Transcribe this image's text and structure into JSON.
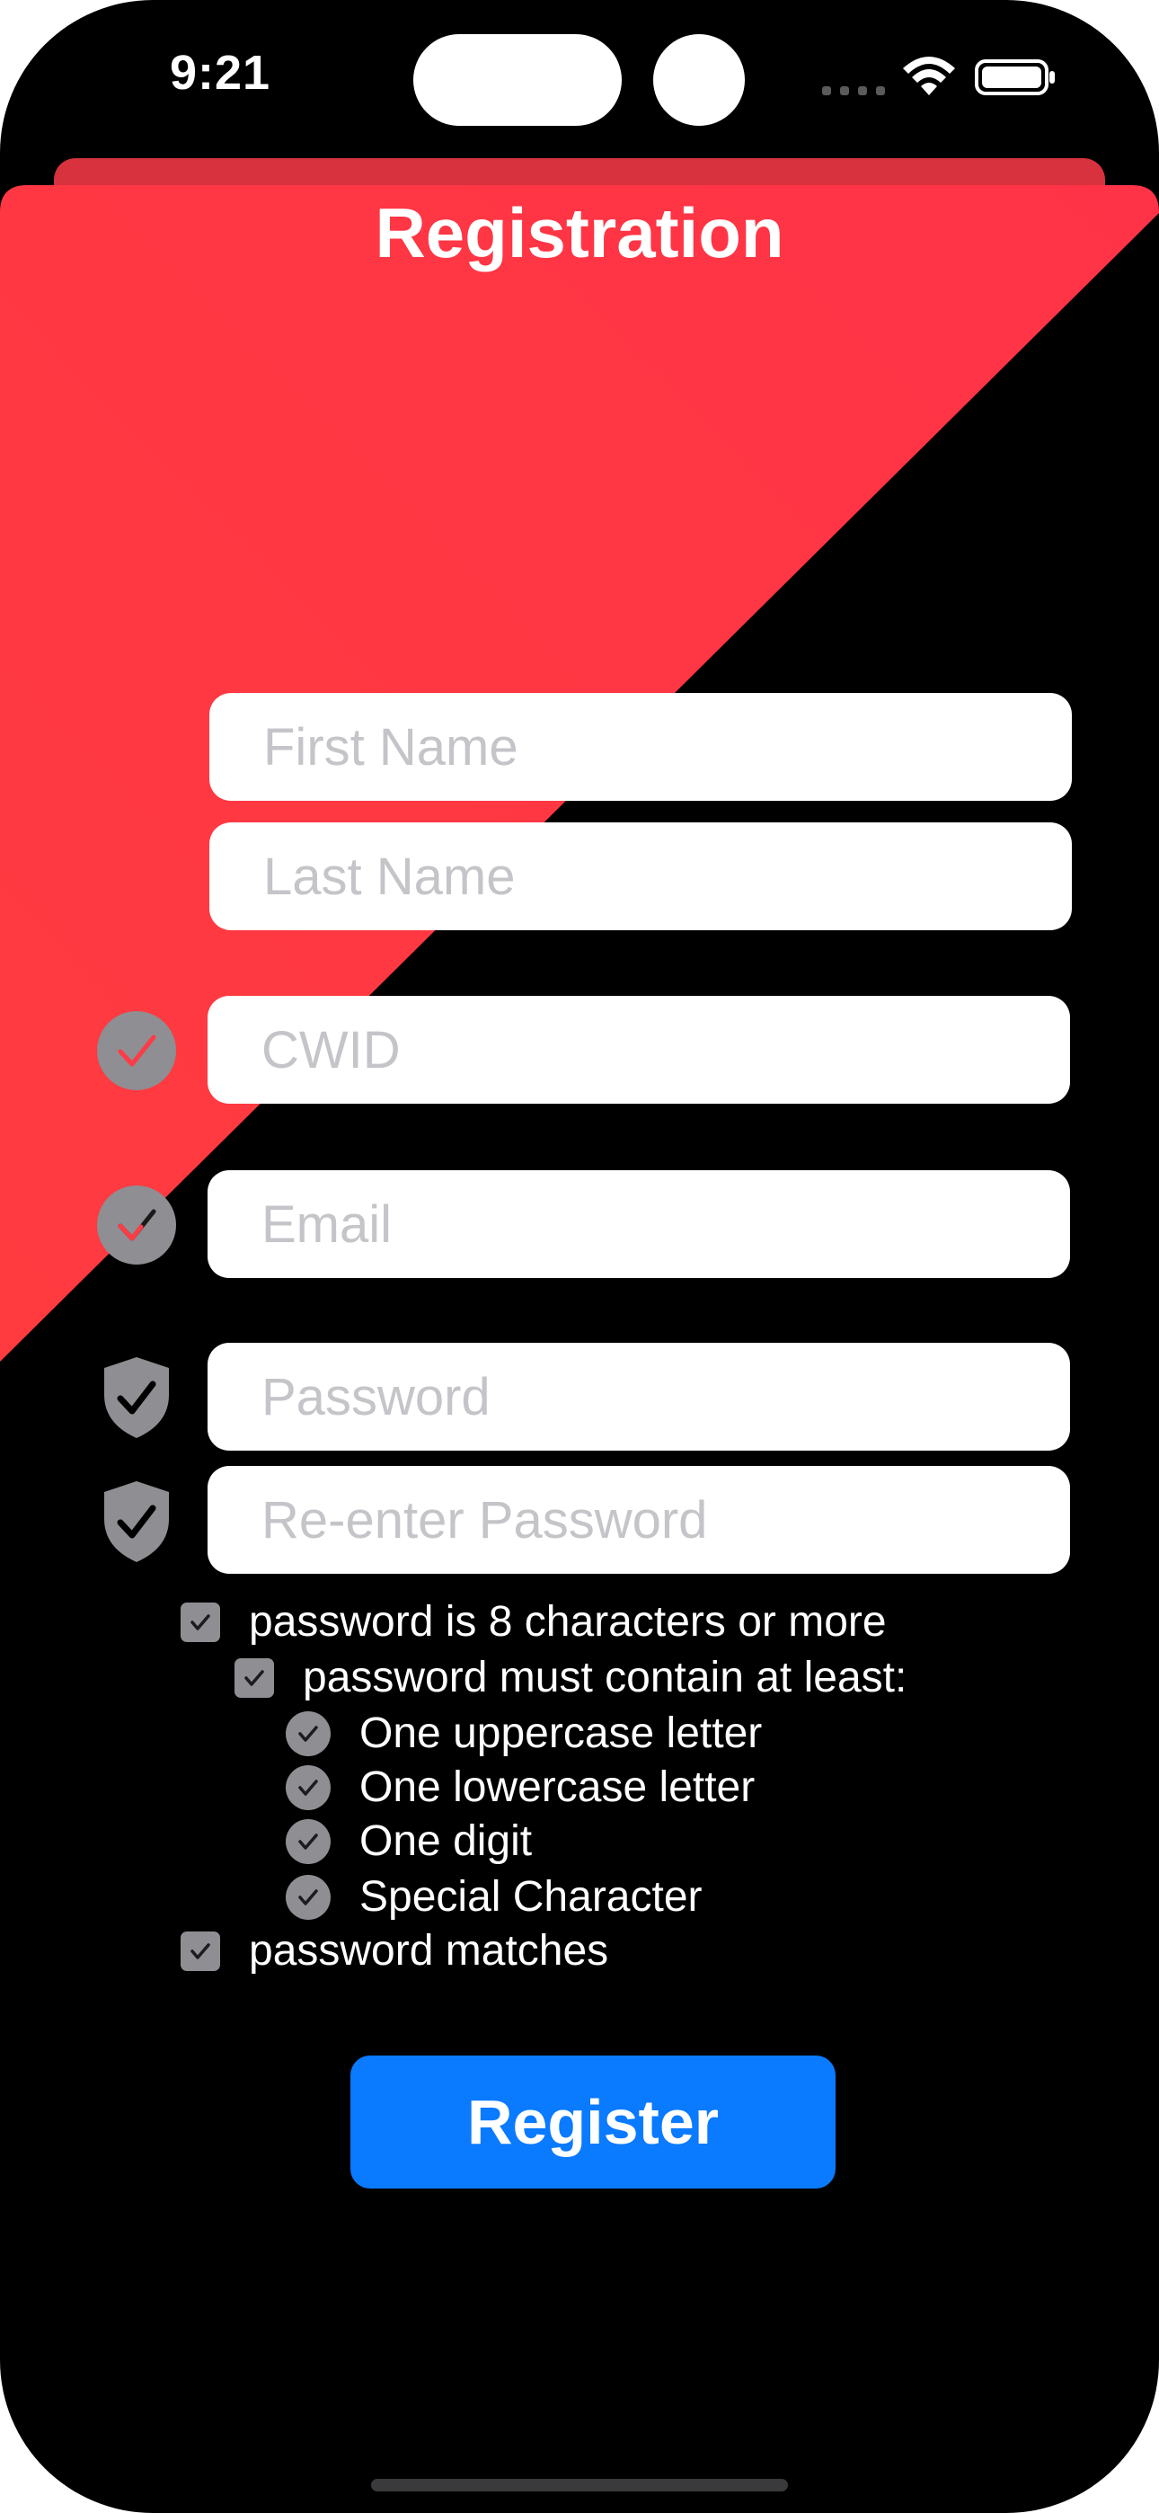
{
  "status_bar": {
    "time": "9:21"
  },
  "header": {
    "title": "Registration"
  },
  "form": {
    "first_name_placeholder": "First Name",
    "last_name_placeholder": "Last Name",
    "cwid_placeholder": "CWID",
    "email_placeholder": "Email",
    "password_placeholder": "Password",
    "reenter_password_placeholder": "Re-enter Password"
  },
  "requirements": {
    "length": "password is 8 characters or more",
    "contain": "password must contain at least:",
    "uppercase": "One uppercase letter",
    "lowercase": "One lowercase letter",
    "digit": "One digit",
    "special": "Special Character",
    "matches": "password matches"
  },
  "actions": {
    "register_label": "Register"
  },
  "colors": {
    "accent_red": "#ff3b45",
    "button_blue": "#0a7aff",
    "indicator_gray": "#8e8e93"
  },
  "icons": {
    "cwid_status": "checkmark-circle-icon",
    "email_status": "checkmark-circle-icon",
    "password_status": "shield-check-icon",
    "reenter_password_status": "shield-check-icon",
    "requirement_checkbox": "checkbox-checked-icon",
    "requirement_bullet": "checkmark-circle-icon"
  }
}
